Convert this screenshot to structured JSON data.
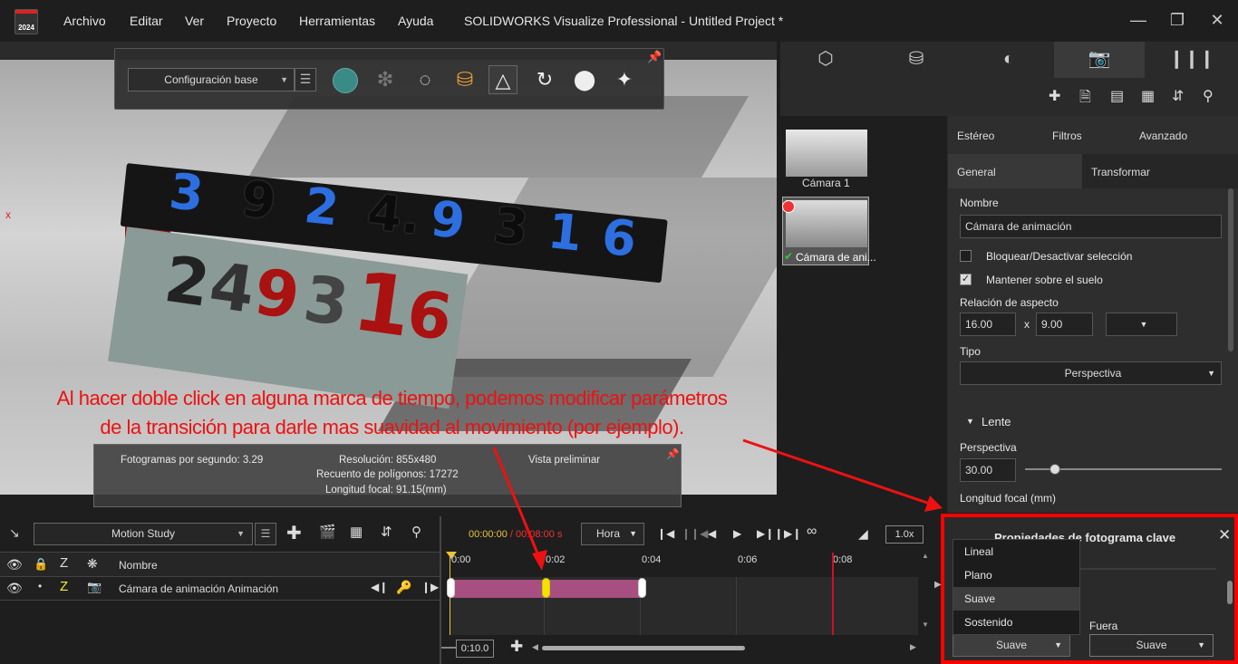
{
  "app": {
    "logo_year": "2024",
    "menu": [
      "Archivo",
      "Editar",
      "Ver",
      "Proyecto",
      "Herramientas",
      "Ayuda"
    ],
    "window_title": "SOLIDWORKS Visualize Professional - Untitled Project *"
  },
  "toolbar": {
    "config_select": "Configuración base"
  },
  "viewport": {
    "axis_label": "x",
    "bar_digits": [
      "3",
      "9",
      "2",
      "4.",
      "9",
      "3",
      "1",
      "6"
    ],
    "front_digits": [
      "2",
      "4",
      "9",
      "3",
      "1",
      "6"
    ],
    "annotation_line1": "Al hacer doble click en alguna marca de tiempo, podemos modificar parámetros",
    "annotation_line2": "de la transición para darle mas suavidad al movimiento (por ejemplo).",
    "stats": {
      "fps": "Fotogramas por segundo: 3.29",
      "resolution": "Resolución: 855x480",
      "polygons": "Recuento de polígonos: 17272",
      "focal": "Longitud focal: 91.15(mm)",
      "preview": "Vista preliminar"
    }
  },
  "cameras": [
    {
      "label": "Cámara 1"
    },
    {
      "label": "Cámara de ani..."
    }
  ],
  "props": {
    "tabs_top": [
      "Estéreo",
      "Filtros",
      "Avanzado"
    ],
    "tabs_second": [
      "General",
      "Transformar"
    ],
    "name_label": "Nombre",
    "name_value": "Cámara de animación",
    "lock_label": "Bloquear/Desactivar selección",
    "ground_label": "Mantener sobre el suelo",
    "aspect_label": "Relación de aspecto",
    "aspect_w": "16.00",
    "aspect_x": "x",
    "aspect_h": "9.00",
    "type_label": "Tipo",
    "type_value": "Perspectiva",
    "lens_label": "Lente",
    "perspective_label": "Perspectiva",
    "perspective_value": "30.00",
    "perspective_slider_fraction": 0.15,
    "focal_label": "Longitud focal (mm)"
  },
  "timeline": {
    "study_select": "Motion Study",
    "time_current": "00:00:00",
    "time_sep": " / ",
    "time_total": "00:08:00 s",
    "time_unit": "Hora",
    "speed": "1.0x",
    "col_name": "Nombre",
    "row_name": "Cámara de animación Animación",
    "ruler": [
      "0:00",
      "0:02",
      "0:04",
      "0:06",
      "0:08"
    ],
    "zoom_value": "0:10.0"
  },
  "keyframe_panel": {
    "title": "Propiedades de fotograma clave",
    "options": [
      "Lineal",
      "Plano",
      "Suave",
      "Sostenido"
    ],
    "selected_option": "Suave",
    "in_value": "Suave",
    "out_label": "Fuera",
    "out_value": "Suave"
  },
  "colors": {
    "annotation": "#e11111",
    "clip": "#a64f80",
    "highlight": "#ff0000"
  }
}
